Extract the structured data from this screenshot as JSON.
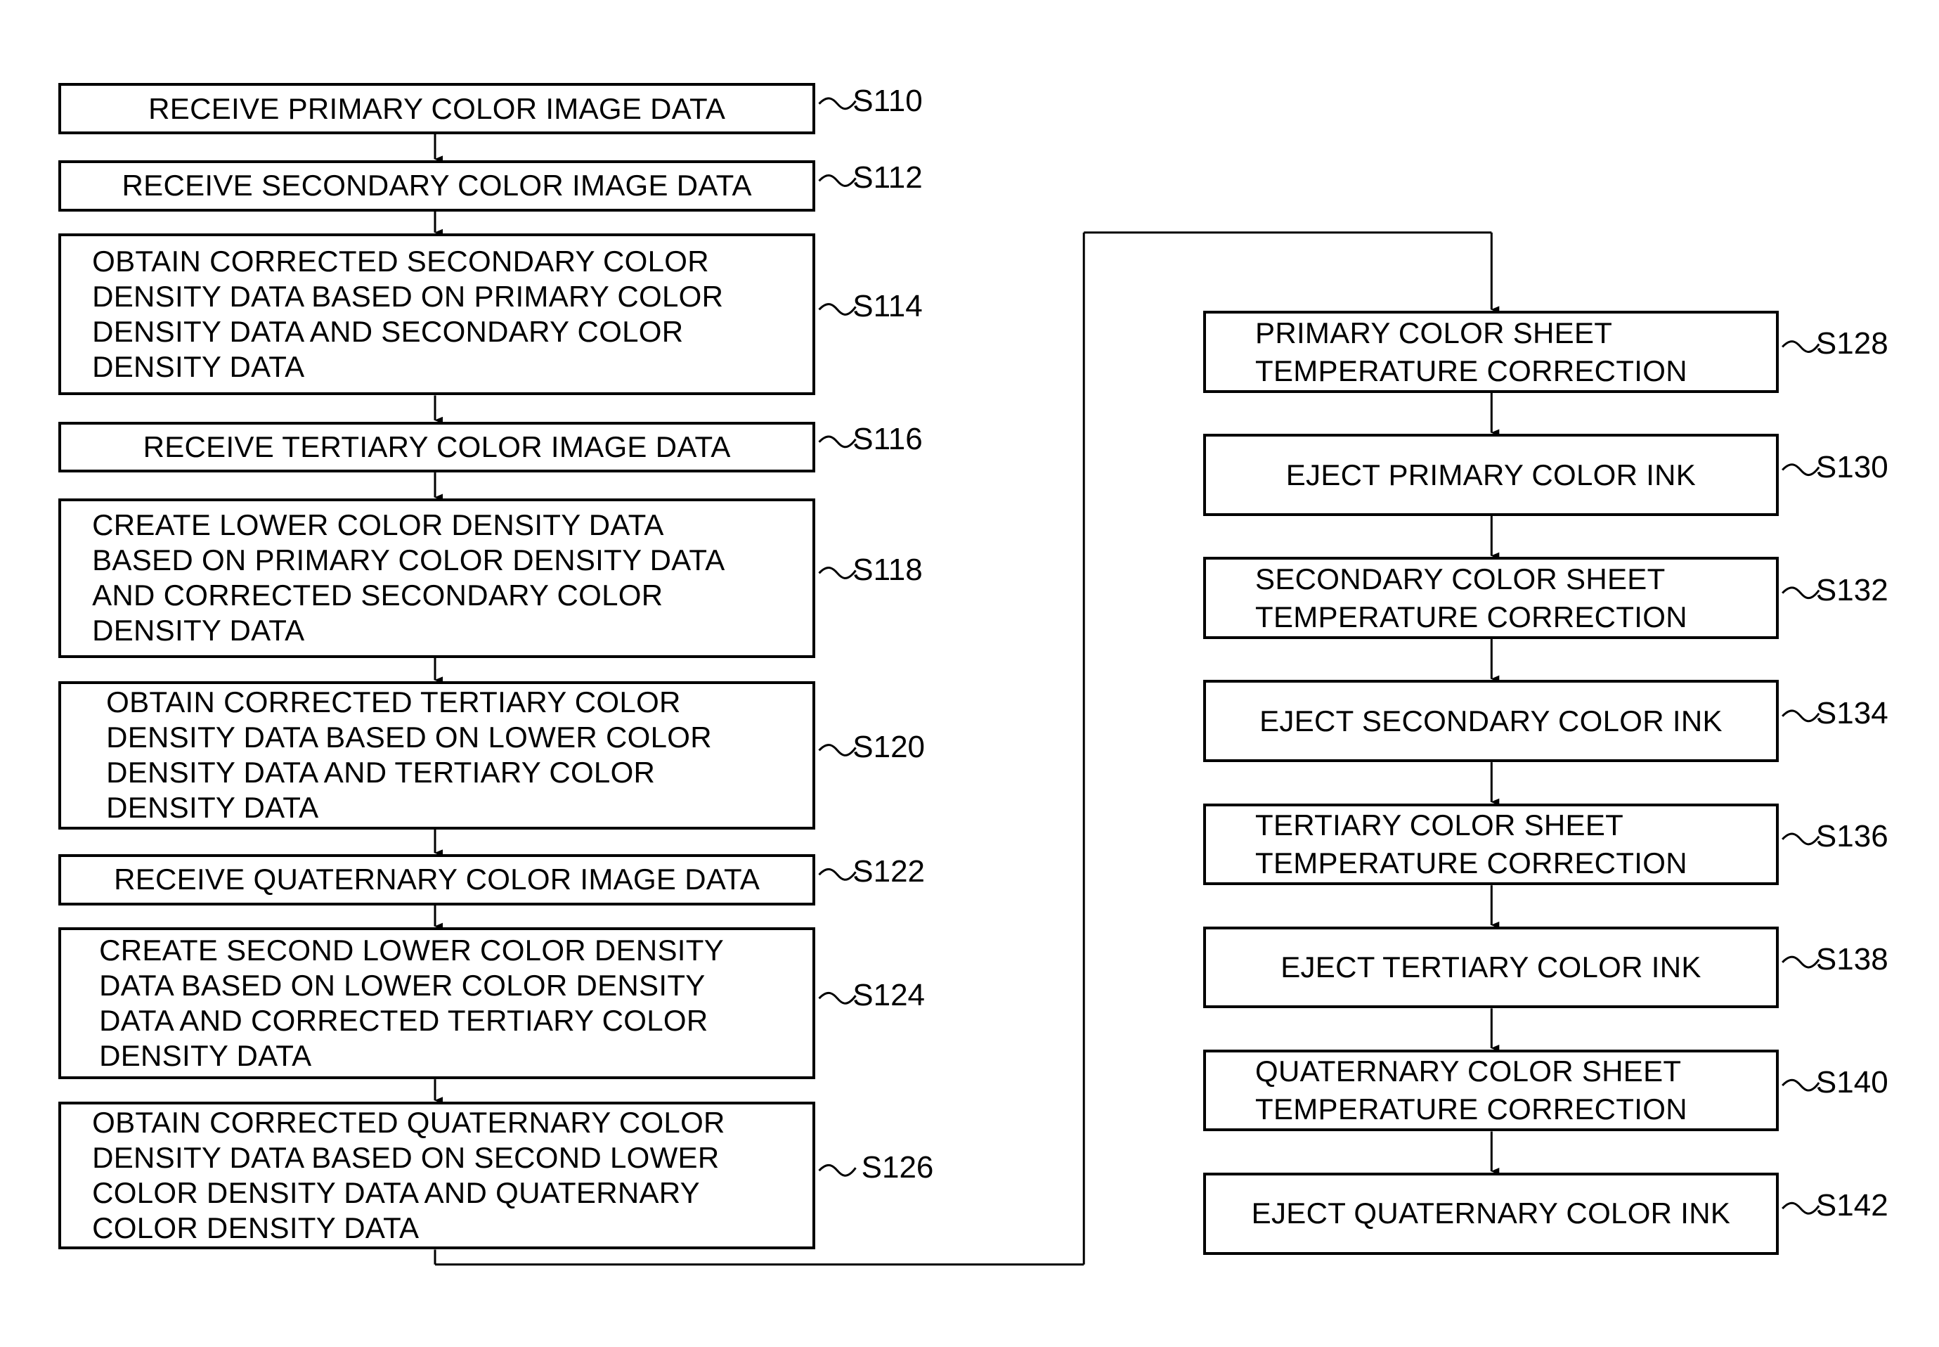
{
  "flowchart": {
    "left_steps": [
      {
        "id": "S110",
        "lines": "RECEIVE PRIMARY COLOR IMAGE DATA",
        "align": "center"
      },
      {
        "id": "S112",
        "lines": "RECEIVE SECONDARY COLOR IMAGE DATA",
        "align": "center"
      },
      {
        "id": "S114",
        "lines": "OBTAIN CORRECTED SECONDARY COLOR\nDENSITY DATA BASED ON PRIMARY COLOR\nDENSITY DATA AND SECONDARY COLOR\nDENSITY DATA",
        "align": "left"
      },
      {
        "id": "S116",
        "lines": "RECEIVE TERTIARY COLOR IMAGE DATA",
        "align": "center"
      },
      {
        "id": "S118",
        "lines": "CREATE LOWER COLOR DENSITY DATA\nBASED ON PRIMARY COLOR DENSITY DATA\nAND CORRECTED SECONDARY COLOR\nDENSITY DATA",
        "align": "left"
      },
      {
        "id": "S120",
        "lines": "OBTAIN CORRECTED TERTIARY COLOR\nDENSITY DATA BASED ON LOWER COLOR\nDENSITY DATA AND TERTIARY COLOR\nDENSITY DATA",
        "align": "left"
      },
      {
        "id": "S122",
        "lines": "RECEIVE QUATERNARY COLOR IMAGE DATA",
        "align": "center"
      },
      {
        "id": "S124",
        "lines": "CREATE SECOND LOWER COLOR DENSITY\nDATA BASED ON LOWER COLOR DENSITY\nDATA AND CORRECTED TERTIARY COLOR\nDENSITY DATA",
        "align": "left"
      },
      {
        "id": "S126",
        "lines": "OBTAIN CORRECTED QUATERNARY COLOR\nDENSITY DATA BASED ON SECOND LOWER\nCOLOR DENSITY DATA AND QUATERNARY\nCOLOR DENSITY DATA",
        "align": "left"
      }
    ],
    "right_steps": [
      {
        "id": "S128",
        "lines": "PRIMARY COLOR SHEET\nTEMPERATURE CORRECTION",
        "align": "left"
      },
      {
        "id": "S130",
        "lines": "EJECT PRIMARY COLOR INK",
        "align": "center"
      },
      {
        "id": "S132",
        "lines": "SECONDARY COLOR SHEET\nTEMPERATURE CORRECTION",
        "align": "left"
      },
      {
        "id": "S134",
        "lines": "EJECT SECONDARY COLOR INK",
        "align": "center"
      },
      {
        "id": "S136",
        "lines": "TERTIARY COLOR SHEET\nTEMPERATURE CORRECTION",
        "align": "left"
      },
      {
        "id": "S138",
        "lines": "EJECT TERTIARY COLOR INK",
        "align": "center"
      },
      {
        "id": "S140",
        "lines": "QUATERNARY COLOR SHEET\nTEMPERATURE CORRECTION",
        "align": "left"
      },
      {
        "id": "S142",
        "lines": "EJECT QUATERNARY COLOR INK",
        "align": "center"
      }
    ]
  }
}
